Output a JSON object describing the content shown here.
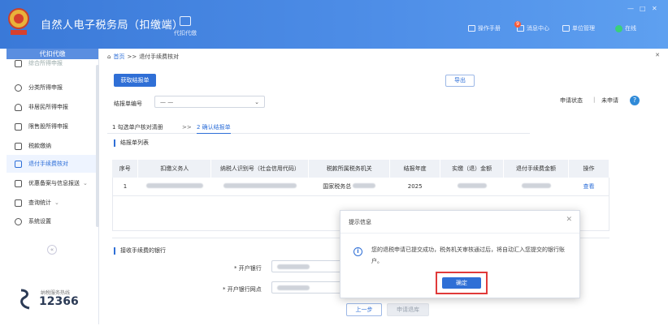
{
  "app": {
    "title": "自然人电子税务局（扣缴端）"
  },
  "top_nav": {
    "proxy": "代扣代缴"
  },
  "toolbar": {
    "manual": "操作手册",
    "messages": "消息中心",
    "message_badge": "9",
    "unit": "单位管理",
    "online": "在线"
  },
  "sidebar": {
    "header": "代扣代缴",
    "items": [
      {
        "label": "综合所得申报",
        "icon": "document-icon"
      },
      {
        "label": "分类所得申报",
        "icon": "clock-icon"
      },
      {
        "label": "非居民所得申报",
        "icon": "person-icon"
      },
      {
        "label": "限售股所得申报",
        "icon": "chart-icon"
      },
      {
        "label": "税款缴纳",
        "icon": "box-icon"
      },
      {
        "label": "退付手续费核对",
        "icon": "list-icon"
      },
      {
        "label": "优惠备案与信息报送",
        "icon": "file-icon"
      },
      {
        "label": "查询统计",
        "icon": "search-icon"
      },
      {
        "label": "系统设置",
        "icon": "gear-icon"
      }
    ],
    "hotline_caption": "纳税服务热线",
    "hotline": "12366"
  },
  "breadcrumb": {
    "home": "首页",
    "sep": ">>",
    "current": "退付手续费核对"
  },
  "actions": {
    "get_report": "获取结报单",
    "export": "导出"
  },
  "form": {
    "report_no_label": "结报单编号",
    "report_no_value": "— —"
  },
  "status": {
    "label": "申请状态",
    "sep": "|",
    "value": "未申请",
    "help": "?"
  },
  "steps": {
    "step1": "1 勾选单户核对清册",
    "arrow": ">>",
    "step2": "2 确认结报单"
  },
  "section_list": "结报单列表",
  "table": {
    "headers": [
      "序号",
      "扣缴义务人",
      "纳税人识别号（社会信用代码）",
      "税款所属税务机关",
      "结报年度",
      "实缴（退）金额",
      "退付手续费金额",
      "操作"
    ],
    "row": {
      "index": "1",
      "tax_office": "国家税务总",
      "year": "2025",
      "action": "查看"
    }
  },
  "section_bank": "接收手续费的银行",
  "bank": {
    "bank_label": "* 开户银行",
    "branch_label": "* 开户银行网点"
  },
  "footer": {
    "prev": "上一步",
    "apply": "申请退库"
  },
  "dialog": {
    "title": "提示信息",
    "message": "您的退税申请已提交成功，税务机关审核通过后，将自动汇入您提交的银行账户。",
    "ok": "确定"
  }
}
